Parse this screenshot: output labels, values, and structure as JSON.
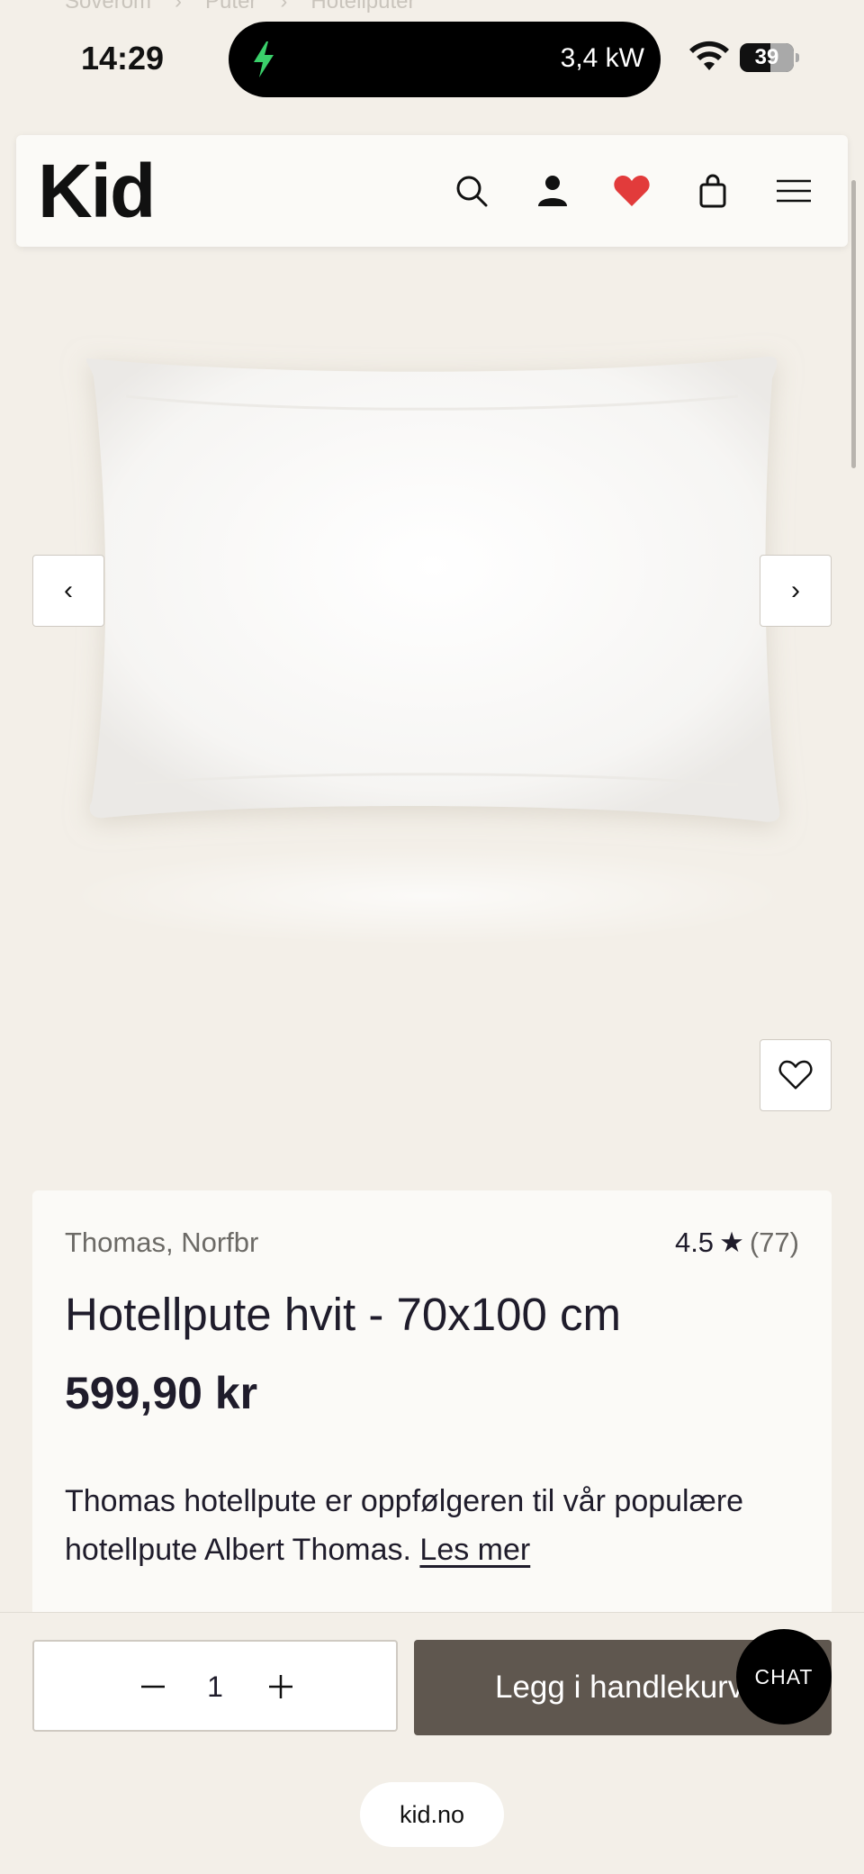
{
  "breadcrumb": [
    "Soverom",
    "Puter",
    "Hotellputer"
  ],
  "status_bar": {
    "time": "14:29",
    "charging_power": "3,4 kW",
    "battery_percent": "39",
    "accent_green": "#3ad06a"
  },
  "header": {
    "logo": "Kid",
    "icons": [
      "search-icon",
      "account-icon",
      "wishlist-heart-icon",
      "cart-bag-icon",
      "menu-icon"
    ],
    "heart_color": "#e23b3b"
  },
  "gallery": {
    "image_alt": "Hotellpute hvit",
    "prev": "‹",
    "next": "›"
  },
  "product": {
    "brand": "Thomas, Norfbr",
    "rating": "4.5",
    "rating_star": "★",
    "rating_count": "(77)",
    "title": "Hotellpute hvit - 70x100 cm",
    "price": "599,90 kr",
    "description": "Thomas hotellpute er oppfølgeren til vår populære hotellpute Albert Thomas.",
    "read_more": "Les mer"
  },
  "purchase": {
    "quantity": "1",
    "add_to_cart": "Legg i handlekurv",
    "chat": "CHAT",
    "button_color": "#5f574f"
  },
  "browser": {
    "domain": "kid.no"
  }
}
